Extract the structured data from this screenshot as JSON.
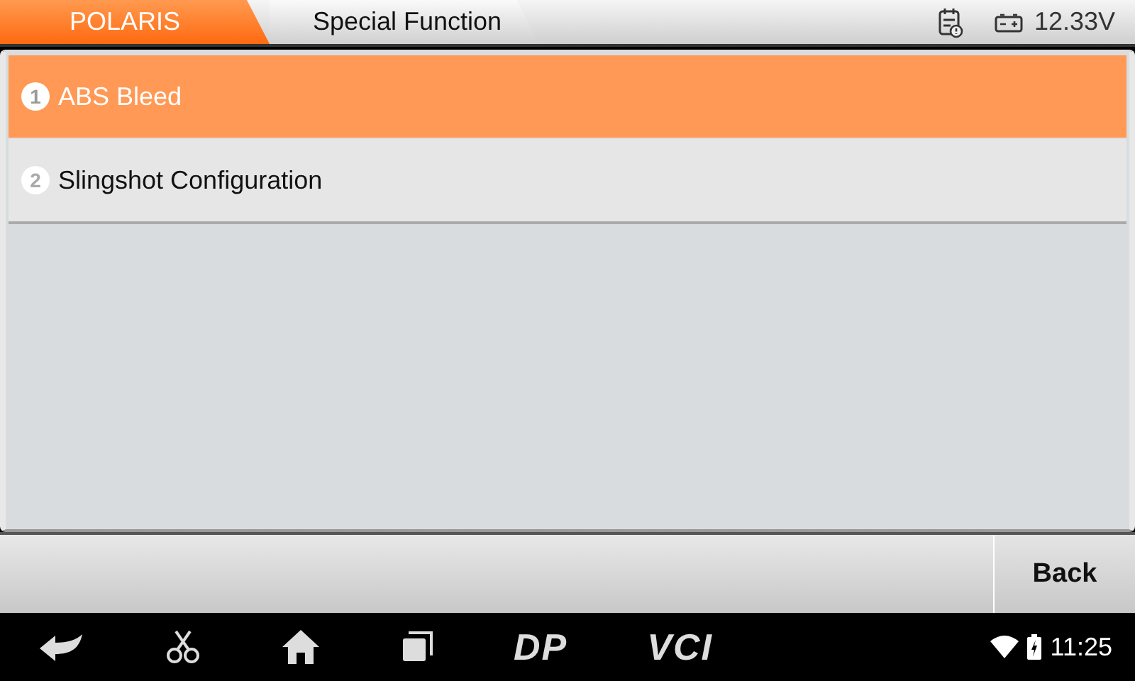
{
  "breadcrumbs": [
    {
      "label": "POLARIS",
      "selected": true
    },
    {
      "label": "Special Function",
      "selected": false
    }
  ],
  "status": {
    "voltage": "12.33V"
  },
  "menu_items": [
    {
      "number": "1",
      "label": "ABS Bleed",
      "selected": true
    },
    {
      "number": "2",
      "label": "Slingshot Configuration",
      "selected": false
    }
  ],
  "buttons": [
    "Back"
  ],
  "nav_bar": {
    "dp_label": "DP",
    "vci_label": "VCI",
    "time": "11:25"
  }
}
